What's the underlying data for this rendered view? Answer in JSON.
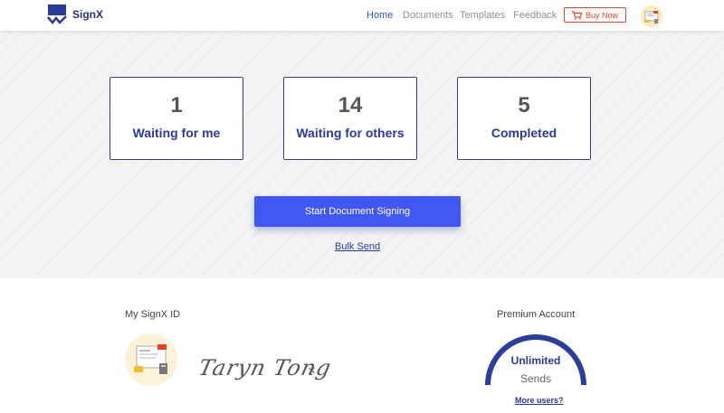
{
  "header": {
    "app_name": "SignX",
    "nav": [
      {
        "label": "Home",
        "active": true
      },
      {
        "label": "Documents",
        "active": false
      },
      {
        "label": "Templates",
        "active": false
      },
      {
        "label": "Feedback",
        "active": false
      }
    ],
    "buy_label": "Buy Now",
    "accent_color": "#3450c7",
    "buy_color": "#e4442e"
  },
  "stats": [
    {
      "count": "1",
      "label": "Waiting for me"
    },
    {
      "count": "14",
      "label": "Waiting for others"
    },
    {
      "count": "5",
      "label": "Completed"
    }
  ],
  "actions": {
    "start_label": "Start Document Signing",
    "bulk_label": "Bulk Send"
  },
  "profile": {
    "id_label": "My SignX ID",
    "signature_text": "Taryn Tong",
    "remove_glyph": "×"
  },
  "account": {
    "title": "Premium Account",
    "gauge_value": "Unlimited",
    "gauge_unit": "Sends",
    "more_label": "More users?",
    "gauge_color": "#2d3d9a"
  }
}
